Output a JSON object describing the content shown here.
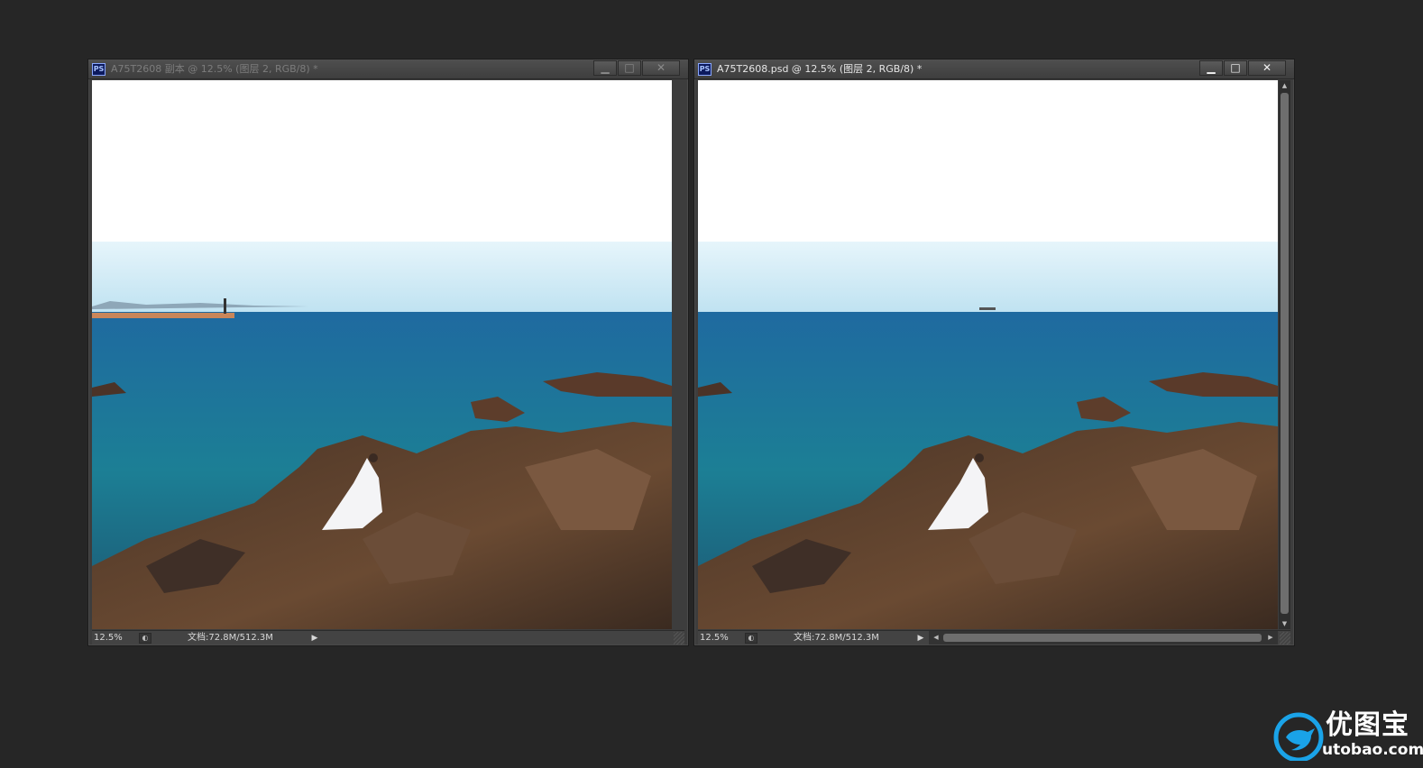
{
  "windows": [
    {
      "id": "left",
      "active": false,
      "app_icon": "PS",
      "title": "A75T2608 副本 @ 12.5% (图层 2, RGB/8) *",
      "controls": {
        "minimize": "▁",
        "maximize": "□",
        "close": "✕"
      },
      "status": {
        "zoom": "12.5%",
        "doc_size": "文档:72.8M/512.3M"
      }
    },
    {
      "id": "right",
      "active": true,
      "app_icon": "PS",
      "title": "A75T2608.psd @ 12.5% (图层 2, RGB/8) *",
      "controls": {
        "minimize": "▁",
        "maximize": "□",
        "close": "✕"
      },
      "status": {
        "zoom": "12.5%",
        "doc_size": "文档:72.8M/512.3M"
      }
    }
  ],
  "watermark": {
    "cn": "优图宝",
    "en": "utobao.com",
    "colors": {
      "bird": "#1aa3e8",
      "text": "#ffffff"
    }
  },
  "icons": {
    "status_arrow": "play-icon",
    "doc_info": "document-info-icon"
  },
  "colors": {
    "workspace": "#262626",
    "window_frame": "#3d3d3d",
    "sea": "#1f6f9a",
    "sky": "#cfeaf6",
    "rocks": "#5a4030"
  }
}
